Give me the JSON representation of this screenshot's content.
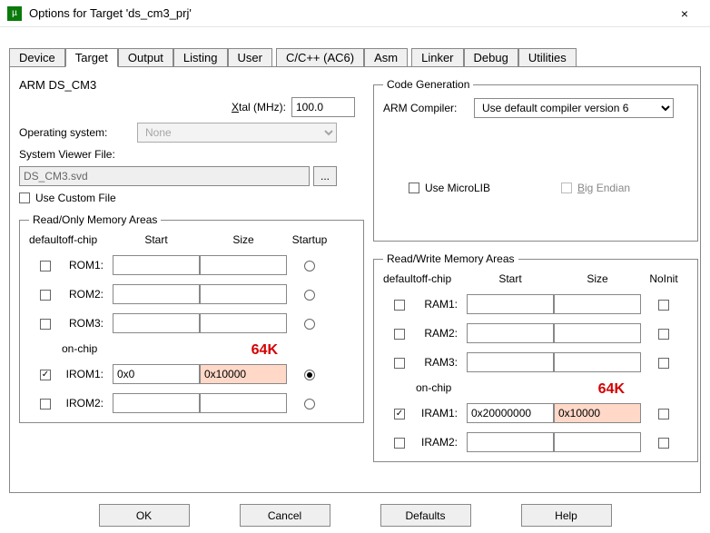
{
  "window": {
    "title": "Options for Target 'ds_cm3_prj'",
    "close": "×"
  },
  "tabs": {
    "device": "Device",
    "target": "Target",
    "output": "Output",
    "listing": "Listing",
    "user": "User",
    "cpp": "C/C++ (AC6)",
    "asm": "Asm",
    "linker": "Linker",
    "debug": "Debug",
    "utilities": "Utilities"
  },
  "target": {
    "device_name": "ARM DS_CM3",
    "xtal_label": "Xtal (MHz):",
    "xtal_value": "100.0",
    "os_label": "Operating system:",
    "os_value": "None",
    "svf_label": "System Viewer File:",
    "svf_value": "DS_CM3.svd",
    "svf_browse": "...",
    "use_custom_label": "Use Custom File"
  },
  "codegen": {
    "legend": "Code Generation",
    "compiler_label": "ARM Compiler:",
    "compiler_value": "Use default compiler version 6",
    "microlib_label": "Use MicroLIB",
    "bigendian_label": "Big Endian"
  },
  "rom": {
    "legend": "Read/Only Memory Areas",
    "hdr_default": "default",
    "hdr_offchip": "off-chip",
    "hdr_start": "Start",
    "hdr_size": "Size",
    "hdr_startup": "Startup",
    "hdr_onchip": "on-chip",
    "rows": {
      "rom1": "ROM1:",
      "rom2": "ROM2:",
      "rom3": "ROM3:",
      "irom1": "IROM1:",
      "irom2": "IROM2:"
    },
    "irom1_start": "0x0",
    "irom1_size": "0x10000",
    "anno": "64K"
  },
  "ram": {
    "legend": "Read/Write Memory Areas",
    "hdr_default": "default",
    "hdr_offchip": "off-chip",
    "hdr_start": "Start",
    "hdr_size": "Size",
    "hdr_noinit": "NoInit",
    "hdr_onchip": "on-chip",
    "rows": {
      "ram1": "RAM1:",
      "ram2": "RAM2:",
      "ram3": "RAM3:",
      "iram1": "IRAM1:",
      "iram2": "IRAM2:"
    },
    "iram1_start": "0x20000000",
    "iram1_size": "0x10000",
    "anno": "64K"
  },
  "buttons": {
    "ok": "OK",
    "cancel": "Cancel",
    "defaults": "Defaults",
    "help": "Help"
  }
}
